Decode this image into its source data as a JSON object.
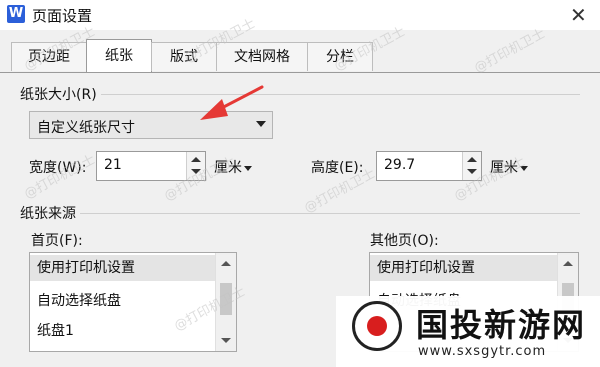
{
  "window": {
    "title": "页面设置",
    "app_icon": "W"
  },
  "tabs": [
    {
      "label": "页边距",
      "active": false
    },
    {
      "label": "纸张",
      "active": true
    },
    {
      "label": "版式",
      "active": false
    },
    {
      "label": "文档网格",
      "active": false
    },
    {
      "label": "分栏",
      "active": false
    }
  ],
  "paper_size": {
    "group_label": "纸张大小(R)",
    "selected": "自定义纸张尺寸",
    "width_label": "宽度(W):",
    "width_value": "21",
    "height_label": "高度(E):",
    "height_value": "29.7",
    "unit": "厘米"
  },
  "paper_source": {
    "group_label": "纸张来源",
    "first_page_label": "首页(F):",
    "first_page_items": [
      "使用打印机设置",
      "自动选择纸盘",
      "纸盘1"
    ],
    "other_pages_label": "其他页(O):",
    "other_pages_items": [
      "使用打印机设置",
      "自动选择纸盘"
    ]
  },
  "watermark_text": "@打印机卫士",
  "brand": {
    "name": "国投新游网",
    "url": "www.sxsgytr.com"
  },
  "colors": {
    "annotation_arrow": "#e53935",
    "brand_dot": "#d81e1e",
    "app_icon": "#2b5fd9"
  }
}
